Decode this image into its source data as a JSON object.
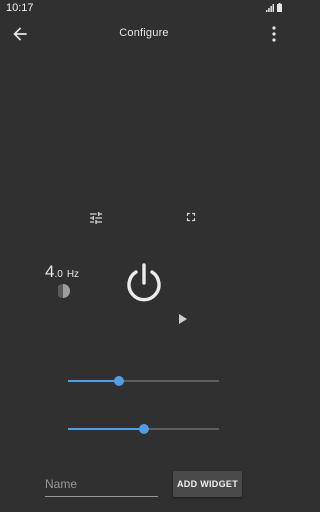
{
  "status_bar": {
    "time": "10:17",
    "icons": [
      "signal-icon",
      "battery-icon"
    ]
  },
  "app_bar": {
    "title": "Configure",
    "back_icon": "arrow-back-icon",
    "menu_icon": "more-vert-icon"
  },
  "controls": {
    "tune_icon": "tune-icon",
    "fullscreen_icon": "fullscreen-icon",
    "frequency": {
      "integer": "4",
      "decimal": ".0",
      "unit": "Hz"
    },
    "duty_icon": "half-circle-icon",
    "power_icon": "power-icon",
    "play_icon": "play-icon"
  },
  "sliders": [
    {
      "name": "slider-1",
      "value": 0.34
    },
    {
      "name": "slider-2",
      "value": 0.5
    }
  ],
  "form": {
    "name_placeholder": "Name",
    "name_value": "",
    "add_button_label": "ADD WIDGET"
  },
  "colors": {
    "background": "#303030",
    "accent": "#4f9eea",
    "button": "#4a4a4a"
  }
}
